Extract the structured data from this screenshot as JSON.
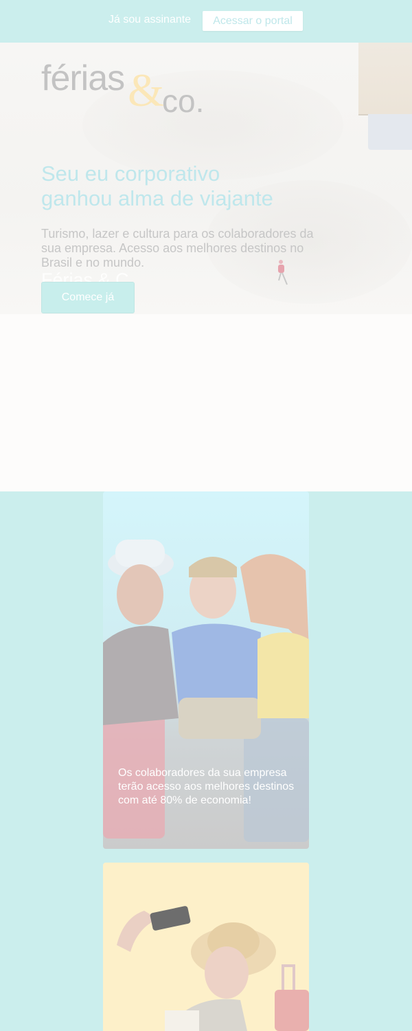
{
  "topbar": {
    "already_subscriber": "Já sou assinante",
    "portal_button": "Acessar o portal"
  },
  "hero": {
    "logo": {
      "ferias": "férias",
      "amp": "&",
      "co": "co."
    },
    "headline_line1": "Seu eu corporativo",
    "headline_line2": "ganhou alma de viajante",
    "subtext": "Turismo, lazer e cultura para os colaboradores da sua empresa. Acesso aos melhores destinos no Brasil e no mundo.",
    "watermark": "Férias & C",
    "cta_button": "Comece já"
  },
  "cards": [
    {
      "caption": "Os colaboradores da sua empresa terão acesso aos melhores destinos com até 80% de economia!"
    }
  ],
  "colors": {
    "teal_background": "#cbeeed",
    "headline": "#bfe7ec",
    "logo_accent": "#fbe7b8"
  }
}
